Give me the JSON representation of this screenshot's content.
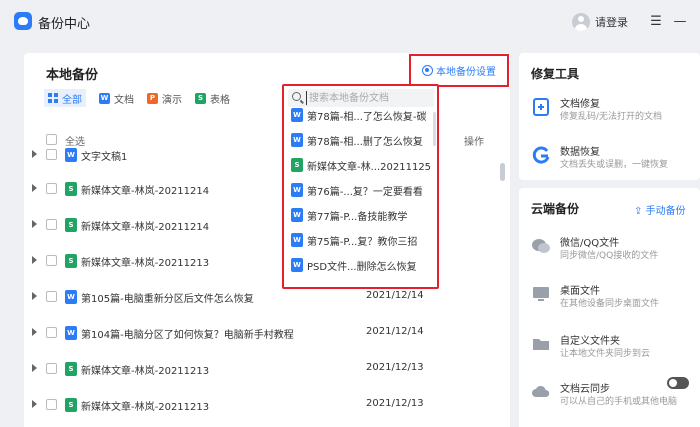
{
  "app": {
    "title": "备份中心"
  },
  "header": {
    "login_label": "请登录",
    "menu_icon": "hamburger-icon",
    "minimize_icon": "minimize-icon"
  },
  "main": {
    "title": "本地备份",
    "settings_label": "本地备份设置",
    "filters": [
      {
        "label": "全部",
        "icon": "grid-icon",
        "active": true
      },
      {
        "label": "文档",
        "icon": "word-icon",
        "color": "#2b7cf6"
      },
      {
        "label": "演示",
        "icon": "ppt-icon",
        "color": "#f0672b"
      },
      {
        "label": "表格",
        "icon": "excel-icon",
        "color": "#1fa463"
      }
    ],
    "table": {
      "select_all": "全选",
      "action_header": "操作"
    },
    "rows": [
      {
        "type": "word",
        "name": "文字文稿1",
        "date": ""
      },
      {
        "type": "excel",
        "name": "新媒体文章-林岚-20211214",
        "date": ""
      },
      {
        "type": "excel",
        "name": "新媒体文章-林岚-20211214",
        "date": ""
      },
      {
        "type": "excel",
        "name": "新媒体文章-林岚-20211213",
        "date": ""
      },
      {
        "type": "word",
        "name": "第105篇-电脑重新分区后文件怎么恢复",
        "date": "2021/12/14"
      },
      {
        "type": "word",
        "name": "第104篇-电脑分区了如何恢复？电脑新手村教程",
        "date": "2021/12/14"
      },
      {
        "type": "excel",
        "name": "新媒体文章-林岚-20211213",
        "date": "2021/12/13"
      },
      {
        "type": "excel",
        "name": "新媒体文章-林岚-20211213",
        "date": "2021/12/13"
      }
    ]
  },
  "dropdown": {
    "search_placeholder": "搜索本地备份文档",
    "items": [
      {
        "type": "word",
        "text": "第78篇-相...了怎么恢复-碳"
      },
      {
        "type": "word",
        "text": "第78篇-相...删了怎么恢复"
      },
      {
        "type": "excel",
        "text": "新媒体文章-林...20211125"
      },
      {
        "type": "word",
        "text": "第76篇-...复？一定要看看"
      },
      {
        "type": "word",
        "text": "第77篇-P...备技能教学"
      },
      {
        "type": "word",
        "text": "第75篇-P...复？教你三招"
      },
      {
        "type": "word",
        "text": "PSD文件...删除怎么恢复"
      }
    ]
  },
  "repair_tools": {
    "title": "修复工具",
    "items": [
      {
        "name": "文档修复",
        "desc": "修复乱码/无法打开的文档",
        "icon": "doc-repair-icon"
      },
      {
        "name": "数据恢复",
        "desc": "文档丢失或误删，一键恢复",
        "icon": "data-recovery-icon"
      }
    ]
  },
  "cloud_backup": {
    "title": "云端备份",
    "manual_label": "手动备份",
    "items": [
      {
        "name": "微信/QQ文件",
        "desc": "同步微信/QQ接收的文件",
        "icon": "chat-icon"
      },
      {
        "name": "桌面文件",
        "desc": "在其他设备同步桌面文件",
        "icon": "desktop-icon"
      },
      {
        "name": "自定义文件夹",
        "desc": "让本地文件夹同步到云",
        "icon": "folder-icon"
      },
      {
        "name": "文档云同步",
        "desc": "可以从自己的手机或其他电脑",
        "icon": "cloud-sync-icon"
      }
    ]
  },
  "colors": {
    "accent": "#2b7cf6",
    "word": "#2b7cf6",
    "excel": "#1fa463",
    "ppt": "#f0672b",
    "highlight": "#e5202e"
  }
}
